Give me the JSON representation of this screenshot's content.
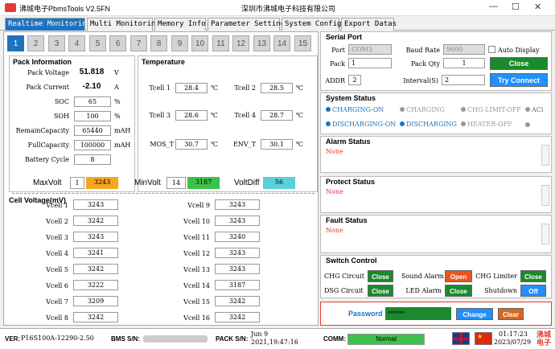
{
  "window": {
    "title": "沸城电子PbmsTools V2.5FN",
    "cn_title": "深圳市沸城电子科技有限公司"
  },
  "tabs": [
    "Realtime Monitoring",
    "Multi Monitoring",
    "Memory Info.",
    "Parameter Setting",
    "System Config.",
    "Export Datas"
  ],
  "pack_tabs": [
    "1",
    "2",
    "3",
    "4",
    "5",
    "6",
    "7",
    "8",
    "9",
    "10",
    "11",
    "12",
    "13",
    "14",
    "15"
  ],
  "pack_info": {
    "title": "Pack Information",
    "rows": [
      {
        "label": "Pack Voltage",
        "value": "51.818",
        "unit": "V"
      },
      {
        "label": "Pack Current",
        "value": "-2.10",
        "unit": "A"
      },
      {
        "label": "SOC",
        "value": "65",
        "unit": "%"
      },
      {
        "label": "SOH",
        "value": "100",
        "unit": "%"
      },
      {
        "label": "RemainCapacity",
        "value": "65440",
        "unit": "mAH"
      },
      {
        "label": "FullCapacity",
        "value": "100000",
        "unit": "mAH"
      },
      {
        "label": "Battery Cycle",
        "value": "8",
        "unit": ""
      }
    ]
  },
  "temperature": {
    "title": "Temperature",
    "unit": "℃",
    "items": [
      {
        "label": "Tcell 1",
        "value": "28.4"
      },
      {
        "label": "Tcell 2",
        "value": "28.5"
      },
      {
        "label": "Tcell 3",
        "value": "28.6"
      },
      {
        "label": "Tcell 4",
        "value": "28.7"
      },
      {
        "label": "MOS_T",
        "value": "30.7"
      },
      {
        "label": "ENV_T",
        "value": "30.1"
      }
    ]
  },
  "cell_voltage": {
    "title": "Cell Voltage(mV)",
    "max_label": "MaxVolt",
    "max_idx": "1",
    "max_val": "3243",
    "min_label": "MinVolt",
    "min_idx": "14",
    "min_val": "3187",
    "diff_label": "VoltDiff",
    "diff_val": "56",
    "colors": {
      "max": "#f5a623",
      "min": "#3cc24a",
      "diff": "#5bd0d8"
    },
    "cells": [
      {
        "label": "Vcell 1",
        "value": "3243"
      },
      {
        "label": "Vcell 2",
        "value": "3242"
      },
      {
        "label": "Vcell 3",
        "value": "3243"
      },
      {
        "label": "Vcell 4",
        "value": "3241"
      },
      {
        "label": "Vcell 5",
        "value": "3242"
      },
      {
        "label": "Vcell 6",
        "value": "3222"
      },
      {
        "label": "Vcell 7",
        "value": "3209"
      },
      {
        "label": "Vcell 8",
        "value": "3242"
      },
      {
        "label": "Vcell 9",
        "value": "3243"
      },
      {
        "label": "Vcell 10",
        "value": "3243"
      },
      {
        "label": "Vcell 11",
        "value": "3240"
      },
      {
        "label": "Vcell 12",
        "value": "3243"
      },
      {
        "label": "Vcell 13",
        "value": "3243"
      },
      {
        "label": "Vcell 14",
        "value": "3187"
      },
      {
        "label": "Vcell 15",
        "value": "3242"
      },
      {
        "label": "Vcell 16",
        "value": "3242"
      }
    ]
  },
  "serial": {
    "title": "Serial Port",
    "port_label": "Port",
    "port": "COM3",
    "baud_label": "Baud Rate",
    "baud": "9600",
    "auto_label": "Auto Display",
    "pack_label": "Pack",
    "pack": "1",
    "qty_label": "Pack Qty",
    "qty": "1",
    "close_label": "Close",
    "addr_label": "ADDR",
    "addr": "2",
    "interval_label": "Interval(S)",
    "interval": "2",
    "connect_label": "Try Connect"
  },
  "system_status": {
    "title": "System Status",
    "row1": [
      "CHARGING-ON",
      "CHARGING",
      "CHG-LIMIT-OFF",
      "ACi"
    ],
    "row2": [
      "DISCHARGING-ON",
      "DISCHARGING",
      "HEATER-OFF",
      ""
    ]
  },
  "alarm": {
    "title": "Alarm Status",
    "value": "None"
  },
  "protect": {
    "title": "Protect Status",
    "value": "None"
  },
  "fault": {
    "title": "Fault Status",
    "value": "None"
  },
  "switch": {
    "title": "Switch Control",
    "items": [
      {
        "label": "CHG Circuit",
        "btn": "Close"
      },
      {
        "label": "Sound Alarm",
        "btn": "Open"
      },
      {
        "label": "CHG Limiter",
        "btn": "Close"
      },
      {
        "label": "DSG Circuit",
        "btn": "Close"
      },
      {
        "label": "LED Alarm",
        "btn": "Close"
      },
      {
        "label": "Shutdown",
        "btn": "Off"
      }
    ]
  },
  "password": {
    "label": "Password",
    "value": "******",
    "change": "Change",
    "clear": "Clear"
  },
  "statusbar": {
    "ver_label": "VER:",
    "ver": "P16S100A-12290-2.50",
    "bms_label": "BMS S/N:",
    "pack_label": "PACK S/N:",
    "pack_date": "Jun  9",
    "pack_time": "2021,19:47:16",
    "comm_label": "COMM:",
    "comm": "Normal",
    "time": "01:17:23",
    "date": "2023/07/29",
    "brand": "沸城电子"
  }
}
